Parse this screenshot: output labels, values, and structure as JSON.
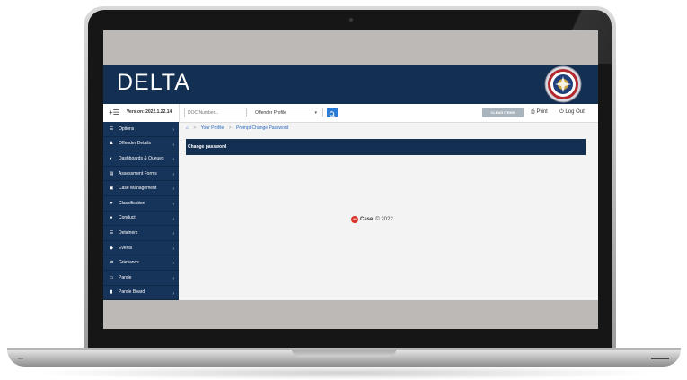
{
  "app": {
    "brand": "DELTA",
    "version": "Version: 2022.1.22.14"
  },
  "toolbar": {
    "menu_toggle": "+☰",
    "doc_number_placeholder": "DOC Number...",
    "profile_select_value": "Offender Profile",
    "print_label": "Print",
    "logout_label": "Log Out",
    "clear_label": "CLEAR ITEMS"
  },
  "breadcrumb": {
    "items": [
      "Your Profile",
      "Prompt Change Password"
    ],
    "separator": ">"
  },
  "main": {
    "title": "Change password"
  },
  "sidebar": {
    "items": [
      {
        "label": "Options",
        "icon": "list-icon"
      },
      {
        "label": "Offender Details",
        "icon": "person-icon"
      },
      {
        "label": "Dashboards & Queues",
        "icon": "dashboard-icon"
      },
      {
        "label": "Assessment Forms",
        "icon": "form-icon"
      },
      {
        "label": "Case Management",
        "icon": "briefcase-icon"
      },
      {
        "label": "Classification",
        "icon": "filter-icon"
      },
      {
        "label": "Conduct",
        "icon": "alert-icon"
      },
      {
        "label": "Detainers",
        "icon": "list-icon"
      },
      {
        "label": "Events",
        "icon": "tag-icon"
      },
      {
        "label": "Grievance",
        "icon": "exchange-icon"
      },
      {
        "label": "Parole",
        "icon": "laptop-icon"
      },
      {
        "label": "Parole Board",
        "icon": "bookmark-icon"
      }
    ]
  },
  "footer": {
    "brand": "Case",
    "copyright": "© 2022"
  },
  "colors": {
    "navy": "#132f52",
    "sidebar": "#16335a",
    "accent": "#2b7bd8",
    "logo_red": "#d9312b"
  }
}
